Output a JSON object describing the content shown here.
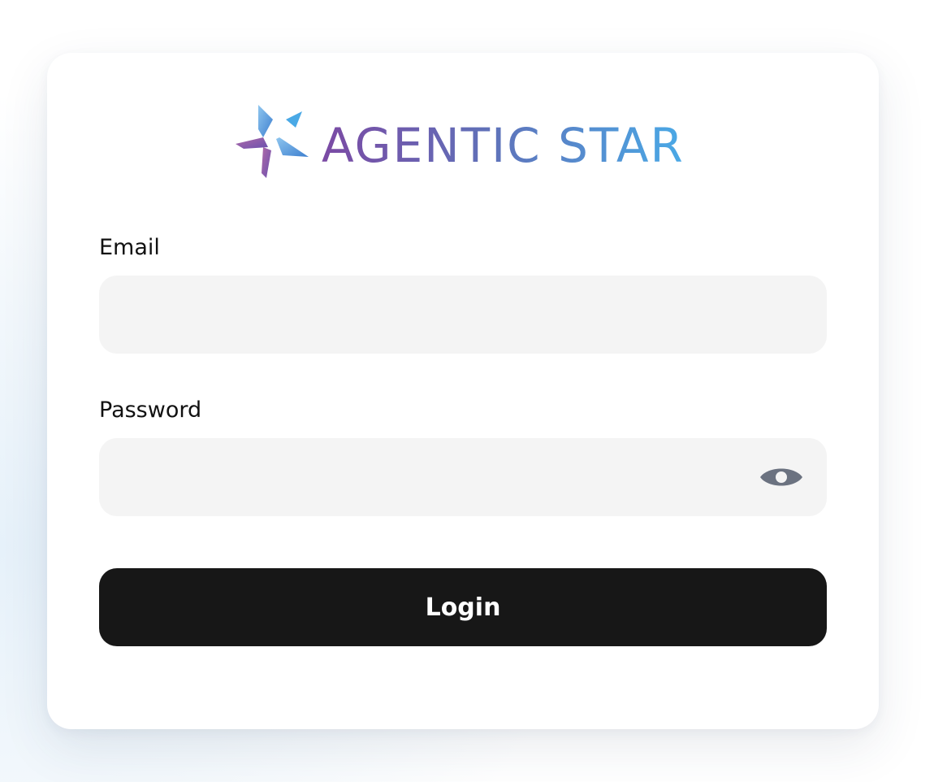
{
  "brand": {
    "name": "AGENTIC STAR",
    "colors": {
      "purple": "#7b4aa4",
      "indigo": "#6070b8",
      "blue": "#3c8fd6",
      "light_blue": "#4aa9e6"
    }
  },
  "form": {
    "email_label": "Email",
    "email_value": "",
    "email_placeholder": "",
    "password_label": "Password",
    "password_value": "",
    "password_placeholder": "",
    "toggle_visibility_icon": "eye-icon",
    "login_label": "Login"
  },
  "colors": {
    "button_background": "#171717",
    "input_background": "#f4f4f4",
    "icon_color": "#6b7280"
  }
}
